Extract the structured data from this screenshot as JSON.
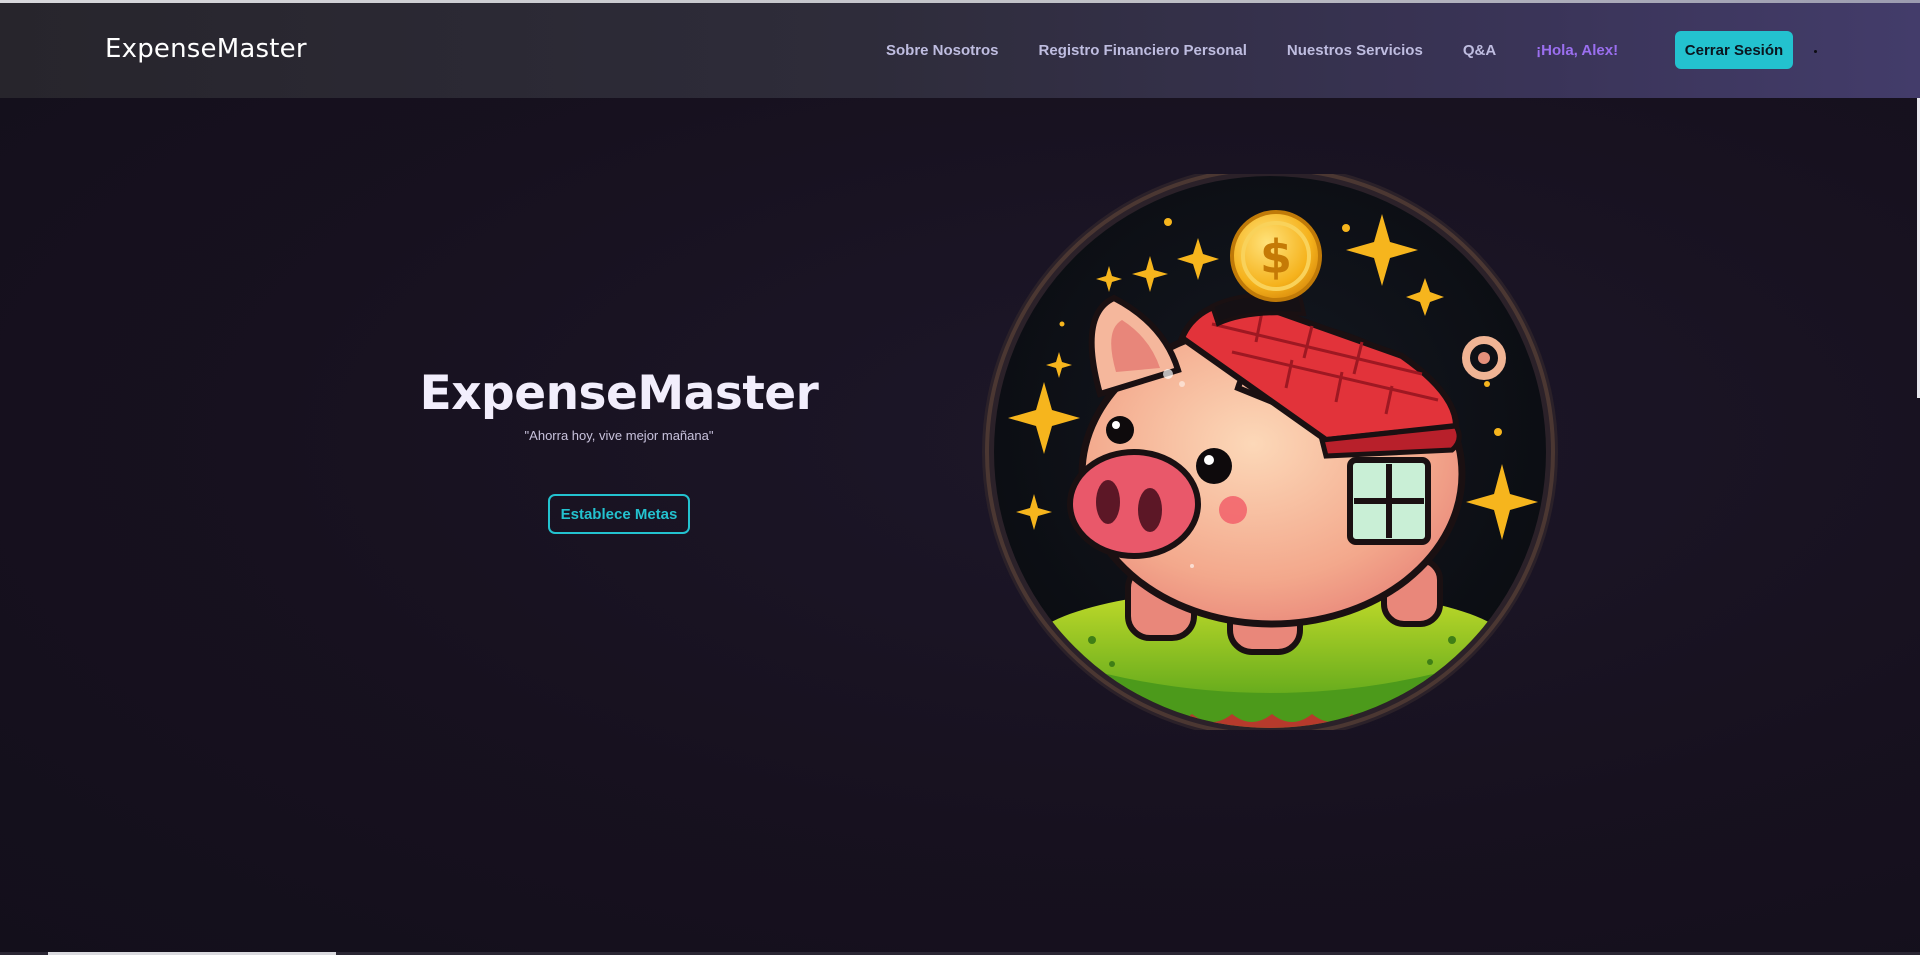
{
  "nav": {
    "brand": "ExpenseMaster",
    "links": [
      "Sobre Nosotros",
      "Registro Financiero Personal",
      "Nuestros Servicios",
      "Q&A"
    ],
    "greeting": "¡Hola, Alex!",
    "logout_label": "Cerrar Sesión"
  },
  "hero": {
    "title": "ExpenseMaster",
    "tagline": "\"Ahorra hoy, vive mejor mañana\"",
    "cta_label": "Establece Metas",
    "illustration_icon": "piggy-bank-house-coin-illustration"
  },
  "colors": {
    "accent": "#23c2cf",
    "greeting": "#9b6ff0",
    "background": "#17121f",
    "nav_text": "#bfbde0"
  }
}
